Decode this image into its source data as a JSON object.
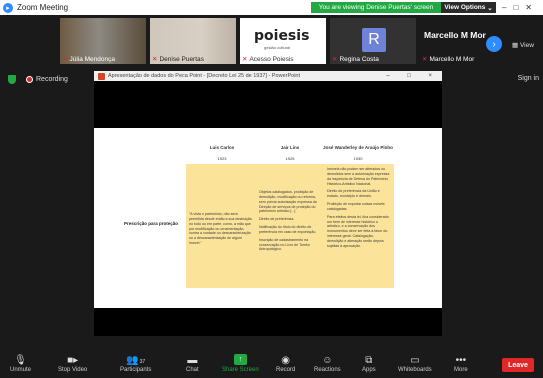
{
  "app": {
    "title": "Zoom Meeting",
    "icon": "zoom-logo-icon"
  },
  "banner": {
    "sharing_text": "You are viewing Denise Puertas' screen",
    "view_options": "View Options"
  },
  "participants": [
    {
      "name": "Júlia Mendonça",
      "muted": true
    },
    {
      "name": "Denise Puertas",
      "muted": true
    },
    {
      "name": "Acesso Poiesis",
      "muted": true,
      "logo": "poiesis",
      "logo_sub": "gestão cultural"
    },
    {
      "name": "Regina Costa",
      "muted": true,
      "avatar": "R"
    },
    {
      "name": "Marcello M Mor",
      "muted": true,
      "display": "Marcello M Mor"
    }
  ],
  "gallery": {
    "view_label": "View"
  },
  "status": {
    "recording": "Recording",
    "sign_in": "Sign in"
  },
  "ppt": {
    "window_title": "Apresentação de dados do Peca Point - [Decreto Lei 25 de 1937] - PowerPoint",
    "controls": "– □ ×"
  },
  "slide": {
    "columns": [
      {
        "name": "Luis Carlos",
        "year": "1923"
      },
      {
        "name": "Jair Lins",
        "year": "1925"
      },
      {
        "name": "José Wanderley de Araújo Pinho",
        "year": "1930"
      }
    ],
    "row_label": "Prescrição para proteção",
    "cells": [
      [
        "\"A vista o patrimônio, não será permitida desde então a sua destruição no todo ou em parte, como, a mão que por modificação ou ornamentação, contra a vontade ou descaracterização ou a descaracterização de algum imóvel.\""
      ],
      [
        "Objetos catalogados, proibição de demolição, modificação ou reforma, sem prévia autorização expressa da Direção de serviços de proteção do patrimônio artístico [...]",
        "Direito de preferência.",
        "Notificação do título do direito de preferência em caso de exportação.",
        "Inscrição de cadastramento na conservação no Livro de Tombo Antropológico."
      ],
      [
        "Imóveis não podem ser alterados ou demolidos sem a autorização expressa da inspetoria de Defesa do Patrimônio Histórico-Artístico Nacional.",
        "Direito de preferência da União e estado, município e demais.",
        "Proibição de exportar coisas móveis catalogadas.",
        "Para efeitos desta lei, fica considerado um bem de interesse histórico o artístico, e a conservação dos monumentos deve ser feita a favor do interesse geral. Catalogação, demolição e alteração serão depois sujeitas à aprovação."
      ]
    ]
  },
  "toolbar": {
    "items": [
      {
        "label": "Unmute",
        "icon": "mic-muted-icon"
      },
      {
        "label": "Stop Video",
        "icon": "video-camera-icon"
      },
      {
        "label": "Participants",
        "icon": "participants-icon",
        "count": "37"
      },
      {
        "label": "Chat",
        "icon": "chat-icon"
      },
      {
        "label": "Share Screen",
        "icon": "share-screen-icon"
      },
      {
        "label": "Record",
        "icon": "record-icon"
      },
      {
        "label": "Reactions",
        "icon": "reactions-icon"
      },
      {
        "label": "Apps",
        "icon": "apps-icon"
      },
      {
        "label": "Whiteboards",
        "icon": "whiteboard-icon"
      },
      {
        "label": "More",
        "icon": "more-icon"
      }
    ],
    "leave": "Leave"
  },
  "colors": {
    "accent": "#2d8cff",
    "share_green": "#23a943",
    "leave_red": "#e02828",
    "slide_cell": "#fbe39a"
  }
}
